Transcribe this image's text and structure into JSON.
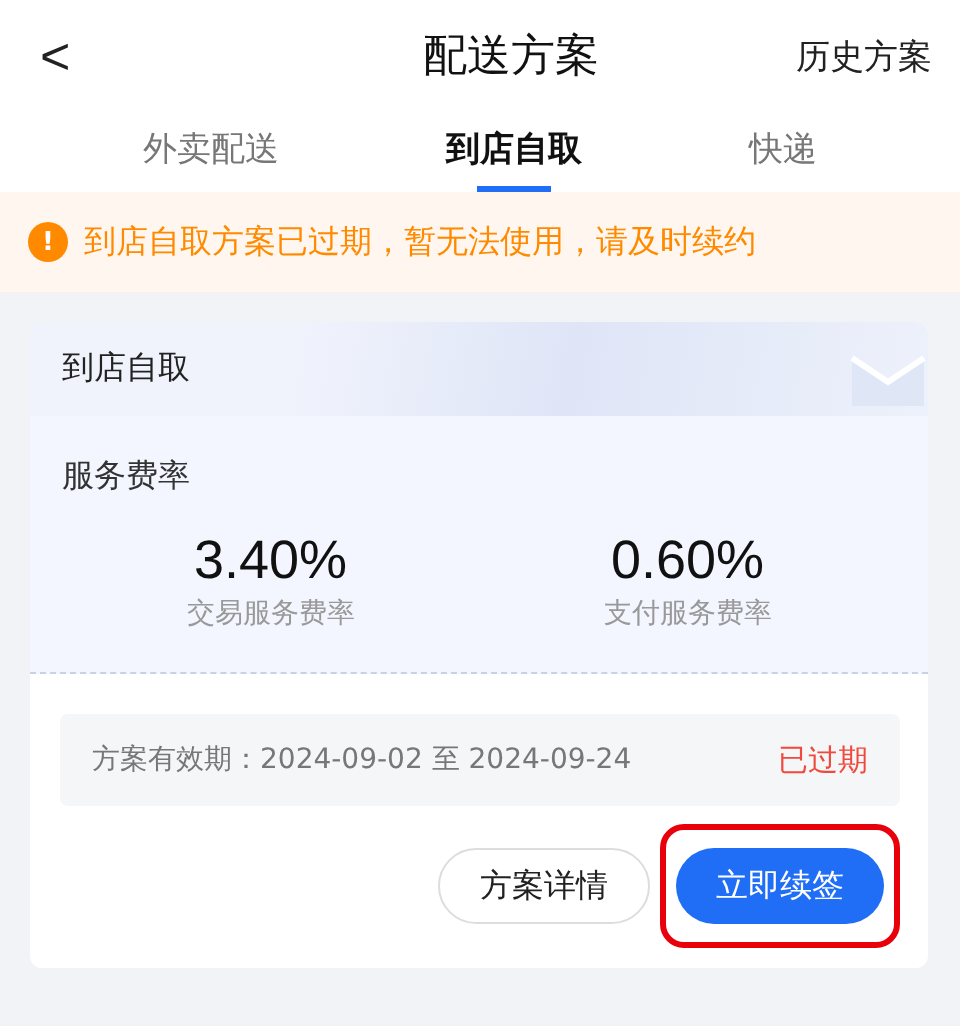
{
  "nav": {
    "back": "<",
    "title": "配送方案",
    "action": "历史方案"
  },
  "tabs": [
    {
      "label": "外卖配送",
      "selected": false
    },
    {
      "label": "到店自取",
      "selected": true
    },
    {
      "label": "快递",
      "selected": false
    }
  ],
  "alert": {
    "icon": "!",
    "text": "到店自取方案已过期，暂无法使用，请及时续约"
  },
  "card": {
    "title": "到店自取",
    "section": "服务费率",
    "rates": [
      {
        "value": "3.40%",
        "label": "交易服务费率"
      },
      {
        "value": "0.60%",
        "label": "支付服务费率"
      }
    ],
    "validity": {
      "text": "方案有效期：2024-09-02 至 2024-09-24",
      "status": "已过期",
      "expired": true
    },
    "buttons": [
      {
        "label": "方案详情",
        "kind": "secondary",
        "highlighted": false
      },
      {
        "label": "立即续签",
        "kind": "primary",
        "highlighted": true
      }
    ]
  }
}
